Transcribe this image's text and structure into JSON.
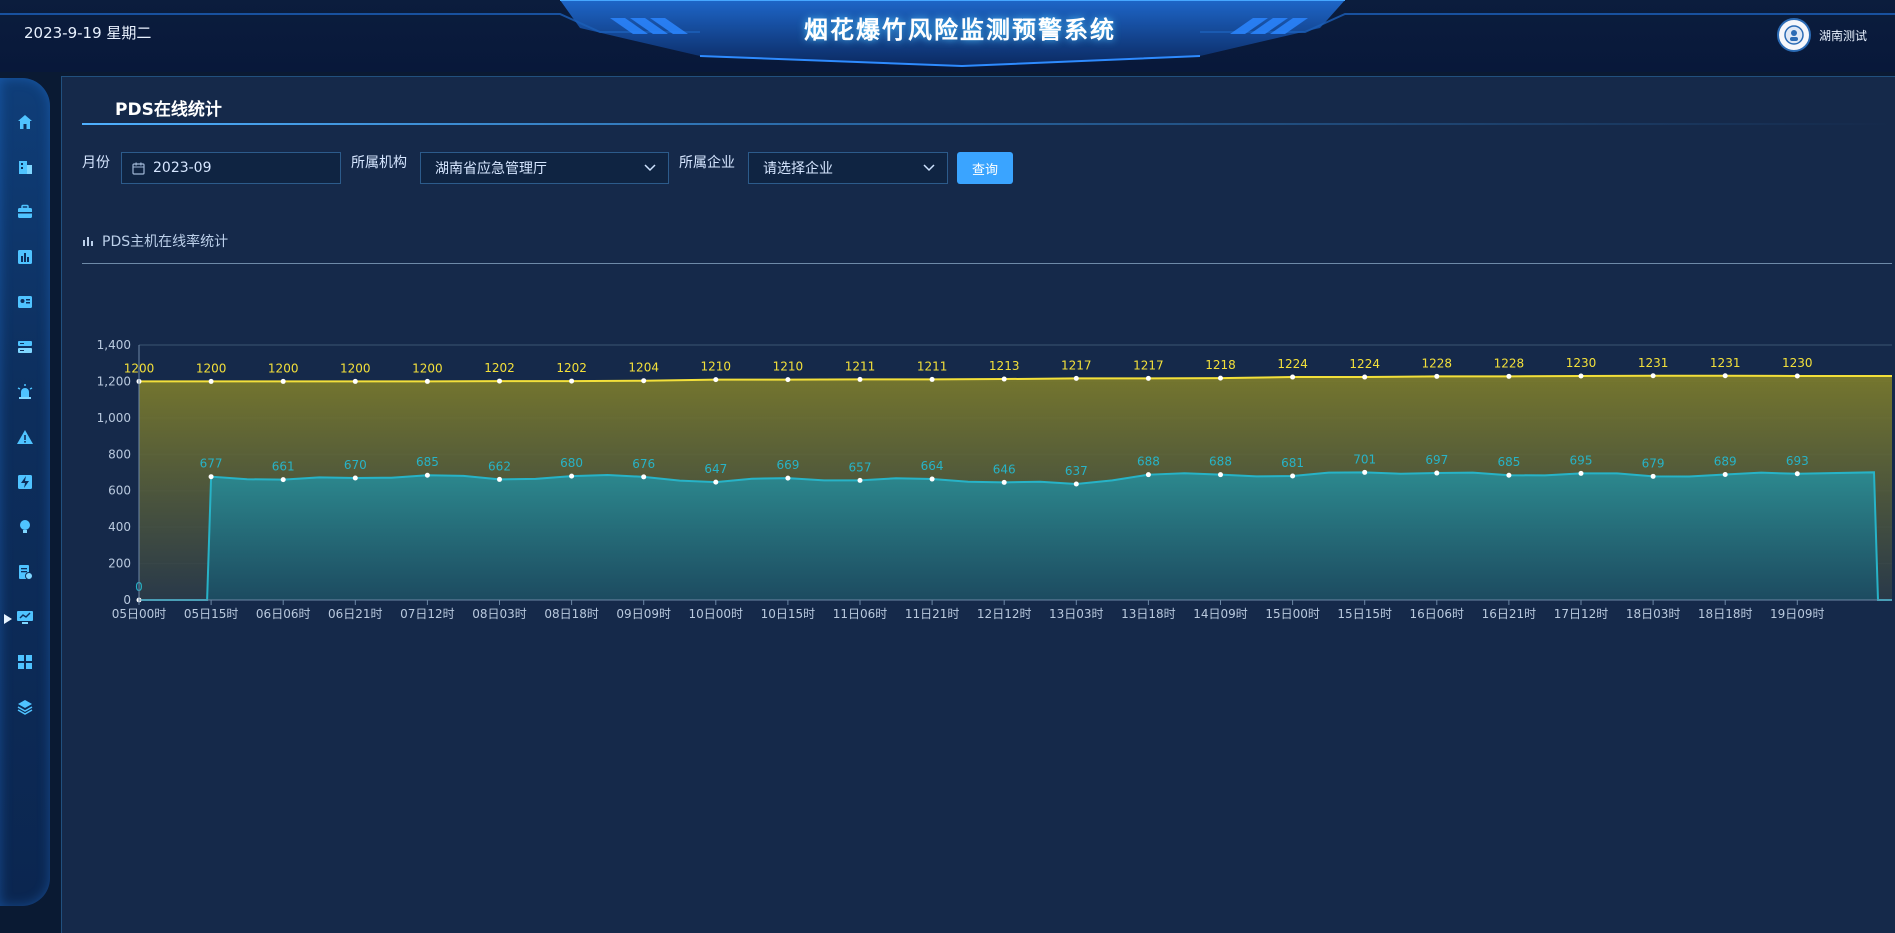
{
  "header": {
    "date": "2023-9-19 星期二",
    "app_title": "烟花爆竹风险监测预警系统",
    "user_name": "湖南测试"
  },
  "sidebar": {
    "items": [
      {
        "icon": "home-icon",
        "active": false
      },
      {
        "icon": "building-icon",
        "active": false
      },
      {
        "icon": "briefcase-icon",
        "active": false
      },
      {
        "icon": "bar-chart-icon",
        "active": false
      },
      {
        "icon": "id-card-icon",
        "active": false
      },
      {
        "icon": "server-icon",
        "active": false
      },
      {
        "icon": "alarm-icon",
        "active": false
      },
      {
        "icon": "warning-icon",
        "active": false
      },
      {
        "icon": "lightning-icon",
        "active": false
      },
      {
        "icon": "bulb-icon",
        "active": false
      },
      {
        "icon": "report-settings-icon",
        "active": false
      },
      {
        "icon": "monitor-icon",
        "active": true
      },
      {
        "icon": "grid-icon",
        "active": false
      },
      {
        "icon": "layers-icon",
        "active": false
      }
    ]
  },
  "panel": {
    "title": "PDS在线统计"
  },
  "filters": {
    "month_label": "月份",
    "month_value": "2023-09",
    "org_label": "所属机构",
    "org_value": "湖南省应急管理厅",
    "company_label": "所属企业",
    "company_placeholder": "请选择企业",
    "query_button": "查询"
  },
  "chart_section": {
    "title": "PDS主机在线率统计"
  },
  "colors": {
    "total_line": "#f3e03a",
    "online_line": "#27b3c7",
    "button": "#3aa4ff"
  },
  "chart_data": {
    "type": "area",
    "ylim": [
      0,
      1400
    ],
    "yticks": [
      0,
      200,
      400,
      600,
      800,
      1000,
      1200,
      1400
    ],
    "ytick_labels": [
      "0",
      "200",
      "400",
      "600",
      "800",
      "1,000",
      "1,200",
      "1,400"
    ],
    "x_tick_labels": [
      "05日00时",
      "05日15时",
      "06日06时",
      "06日21时",
      "07日12时",
      "08日03时",
      "08日18时",
      "09日09时",
      "10日00时",
      "10日15时",
      "11日06时",
      "11日21时",
      "12日12时",
      "13日03时",
      "13日18时",
      "14日09时",
      "15日00时",
      "15日15时",
      "16日06时",
      "16日21时",
      "17日12时",
      "18日03时",
      "18日18时",
      "19日09时"
    ],
    "grid": true,
    "series": [
      {
        "values": [
          1200,
          1200,
          1200,
          1200,
          1200,
          1202,
          1202,
          1204,
          1210,
          1210,
          1211,
          1211,
          1213,
          1217,
          1217,
          1218,
          1224,
          1224,
          1228,
          1228,
          1230,
          1231,
          1231,
          1230
        ],
        "labels": [
          "1200",
          "1200",
          "1200",
          "1200",
          "1200",
          "1202",
          "1202",
          "1204",
          "1210",
          "1210",
          "1211",
          "1211",
          "1213",
          "1217",
          "1217",
          "1218",
          "1224",
          "1224",
          "1228",
          "1228",
          "1230",
          "1231",
          "1231",
          "1230"
        ]
      },
      {
        "values": [
          0,
          677,
          661,
          670,
          685,
          662,
          680,
          676,
          647,
          669,
          657,
          664,
          646,
          637,
          688,
          688,
          681,
          701,
          697,
          685,
          695,
          679,
          689,
          693
        ],
        "labels": [
          "0",
          "677",
          "661",
          "670",
          "685",
          "662",
          "680",
          "676",
          "647",
          "669",
          "657",
          "664",
          "646",
          "637",
          "688",
          "688",
          "681",
          "701",
          "697",
          "685",
          "695",
          "679",
          "689",
          "693"
        ]
      }
    ]
  }
}
